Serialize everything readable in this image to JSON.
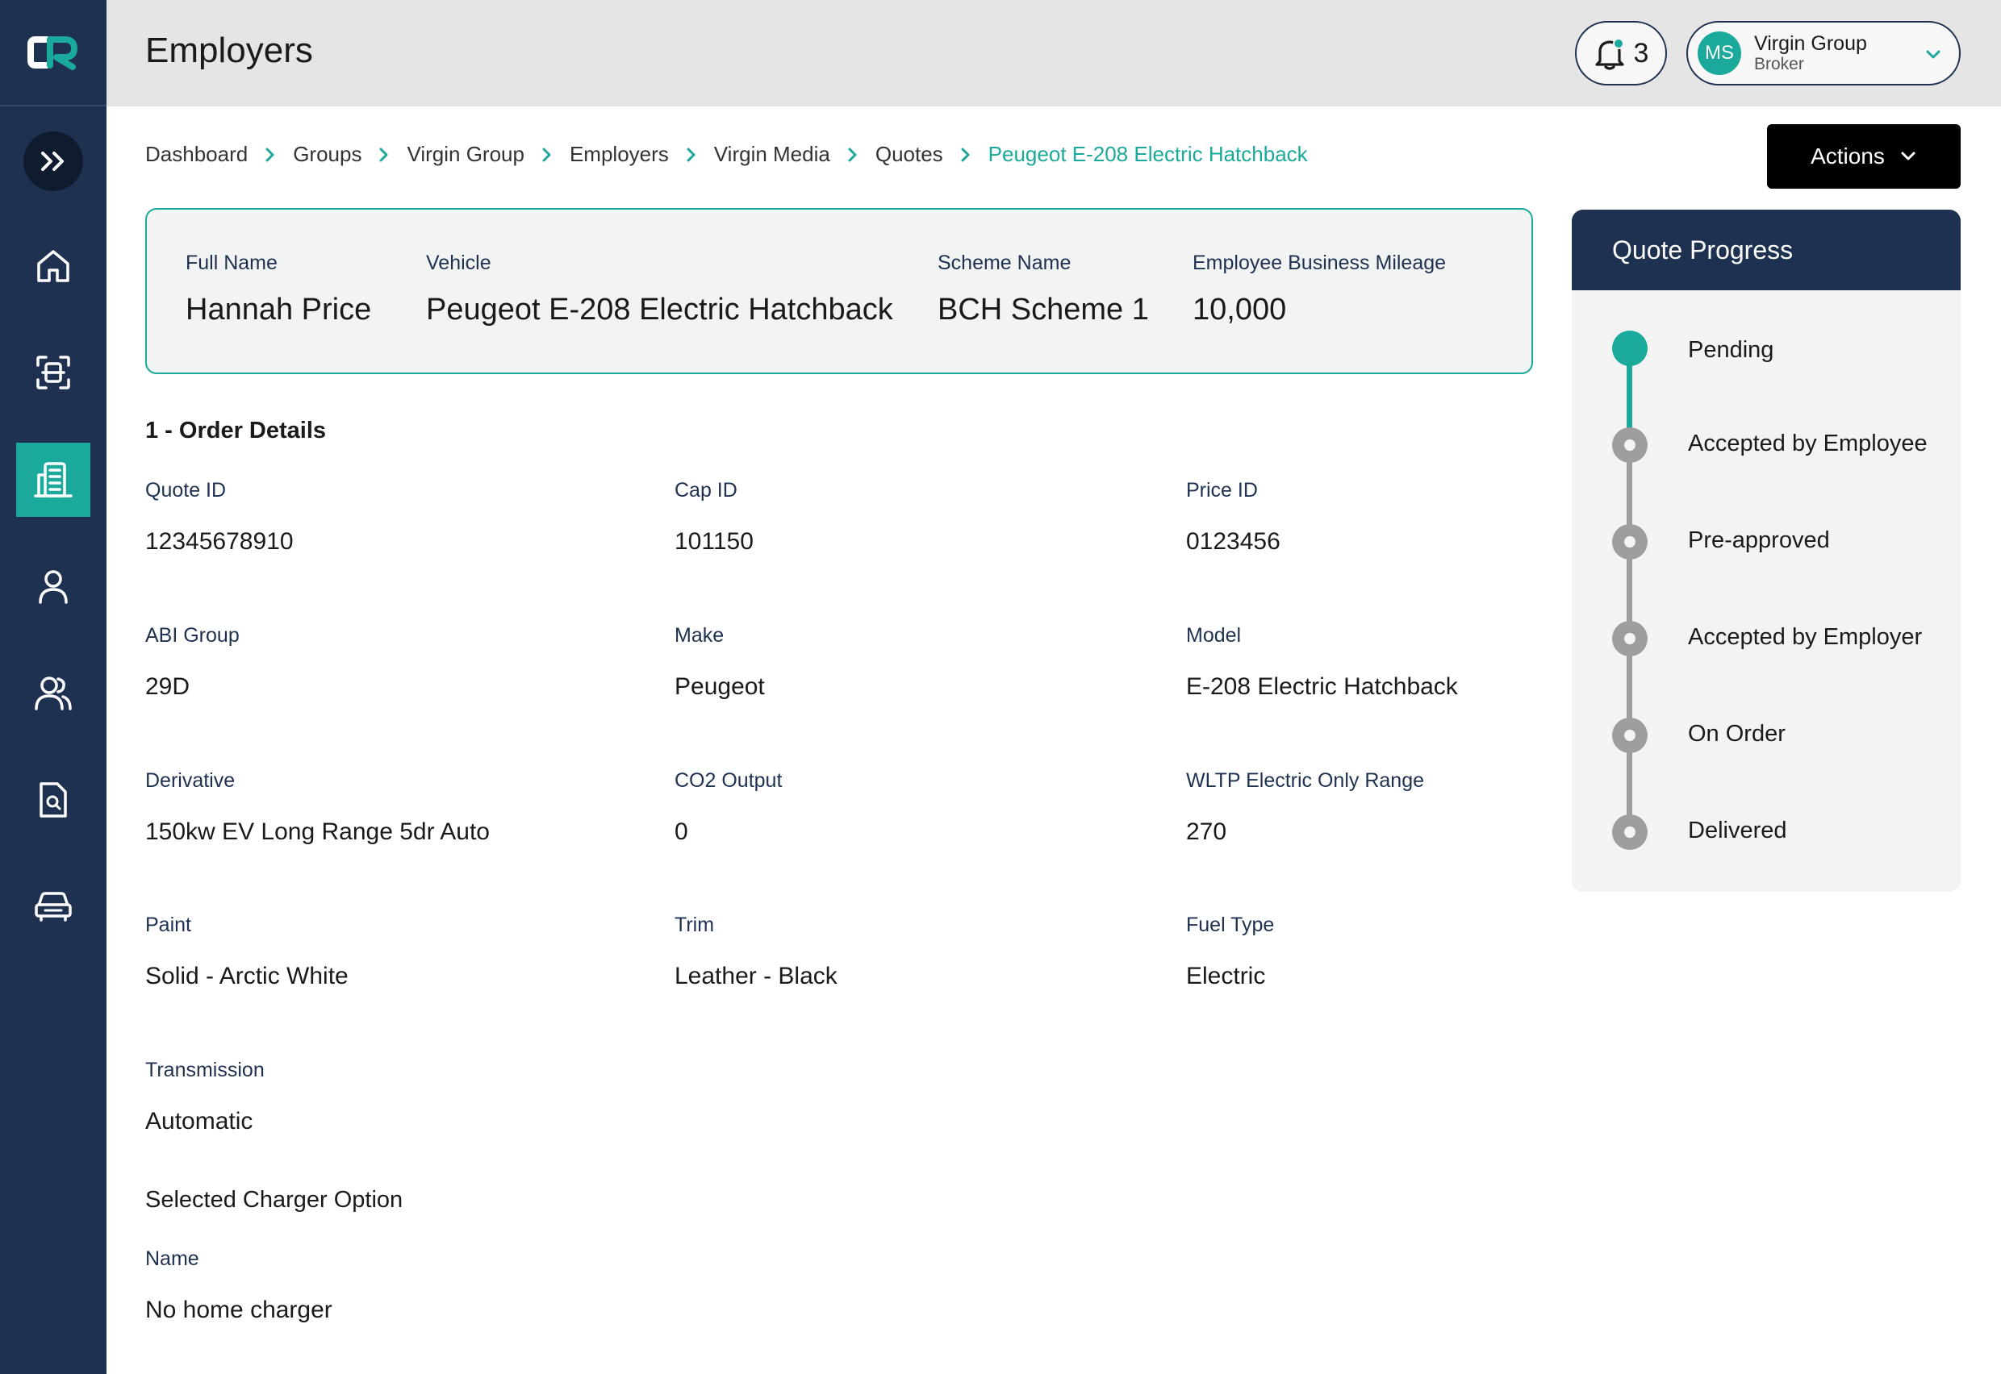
{
  "colors": {
    "sidebar": "#1f3150",
    "accent": "#1aa99a",
    "topbar": "#e5e5e5",
    "actions": "#000000"
  },
  "sidebar": {
    "items": [
      {
        "icon": "home-icon"
      },
      {
        "icon": "scan-icon"
      },
      {
        "icon": "building-icon",
        "active": true
      },
      {
        "icon": "user-icon"
      },
      {
        "icon": "users-icon"
      },
      {
        "icon": "document-search-icon"
      },
      {
        "icon": "car-icon"
      }
    ]
  },
  "header": {
    "title": "Employers",
    "notifications_count": "3",
    "user": {
      "initials": "MS",
      "name": "Virgin Group",
      "role": "Broker"
    }
  },
  "breadcrumb": [
    "Dashboard",
    "Groups",
    "Virgin Group",
    "Employers",
    "Virgin Media",
    "Quotes",
    "Peugeot E-208 Electric Hatchback"
  ],
  "actions_label": "Actions",
  "summary": {
    "full_name": {
      "label": "Full Name",
      "value": "Hannah Price"
    },
    "vehicle": {
      "label": "Vehicle",
      "value": "Peugeot E-208 Electric Hatchback"
    },
    "scheme": {
      "label": "Scheme Name",
      "value": "BCH Scheme 1"
    },
    "mileage": {
      "label": "Employee Business Mileage",
      "value": "10,000"
    }
  },
  "order": {
    "title": "1 - Order Details",
    "fields": [
      {
        "label": "Quote ID",
        "value": "12345678910"
      },
      {
        "label": "Cap ID",
        "value": "101150"
      },
      {
        "label": "Price ID",
        "value": "0123456"
      },
      {
        "label": "ABI Group",
        "value": "29D"
      },
      {
        "label": "Make",
        "value": "Peugeot"
      },
      {
        "label": "Model",
        "value": "E-208 Electric Hatchback"
      },
      {
        "label": "Derivative",
        "value": "150kw EV Long Range 5dr Auto"
      },
      {
        "label": "CO2 Output",
        "value": "0"
      },
      {
        "label": "WLTP Electric Only Range",
        "value": "270"
      },
      {
        "label": "Paint",
        "value": "Solid - Arctic White"
      },
      {
        "label": "Trim",
        "value": "Leather - Black"
      },
      {
        "label": "Fuel Type",
        "value": "Electric"
      },
      {
        "label": "Transmission",
        "value": "Automatic"
      }
    ]
  },
  "charger": {
    "title": "Selected Charger Option",
    "name": {
      "label": "Name",
      "value": "No home charger"
    }
  },
  "progress": {
    "title": "Quote Progress",
    "current_step": 0,
    "steps": [
      "Pending",
      "Accepted by Employee",
      "Pre-approved",
      "Accepted by Employer",
      "On Order",
      "Delivered"
    ]
  }
}
